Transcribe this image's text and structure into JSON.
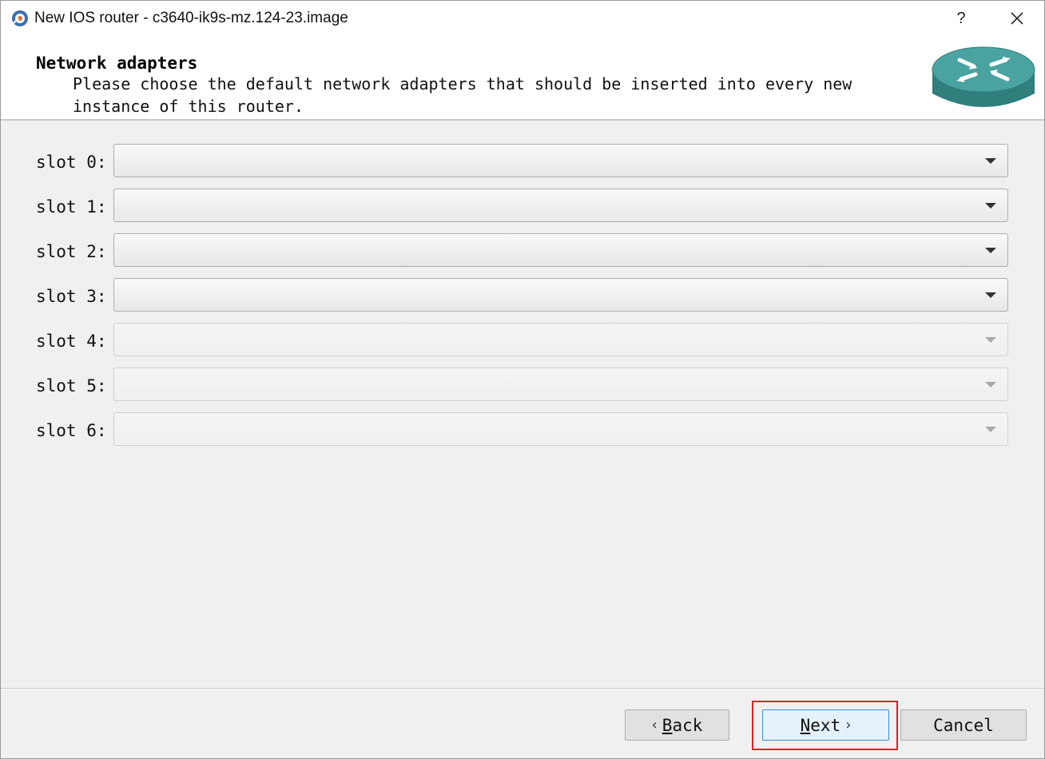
{
  "window": {
    "title": "New IOS router - c3640-ik9s-mz.124-23.image",
    "help_label": "?",
    "close_label": "✕"
  },
  "header": {
    "title": "Network adapters",
    "subtitle_line1": "Please choose the default network adapters that should be inserted into every new",
    "subtitle_line2": "instance of this router.",
    "icon": "router-icon"
  },
  "slots": [
    {
      "label": "slot 0:",
      "value": "",
      "enabled": true
    },
    {
      "label": "slot 1:",
      "value": "",
      "enabled": true
    },
    {
      "label": "slot 2:",
      "value": "",
      "enabled": true
    },
    {
      "label": "slot 3:",
      "value": "",
      "enabled": true
    },
    {
      "label": "slot 4:",
      "value": "",
      "enabled": false
    },
    {
      "label": "slot 5:",
      "value": "",
      "enabled": false
    },
    {
      "label": "slot 6:",
      "value": "",
      "enabled": false
    }
  ],
  "buttons": {
    "back_mnemonic": "B",
    "back_rest": "ack",
    "back_chevron": "‹",
    "next_mnemonic": "N",
    "next_rest": "ext",
    "next_chevron": "›",
    "cancel": "Cancel"
  },
  "colors": {
    "router_teal": "#2f8a88",
    "highlight": "#e02020",
    "default_button_border": "#3c8fd6"
  }
}
